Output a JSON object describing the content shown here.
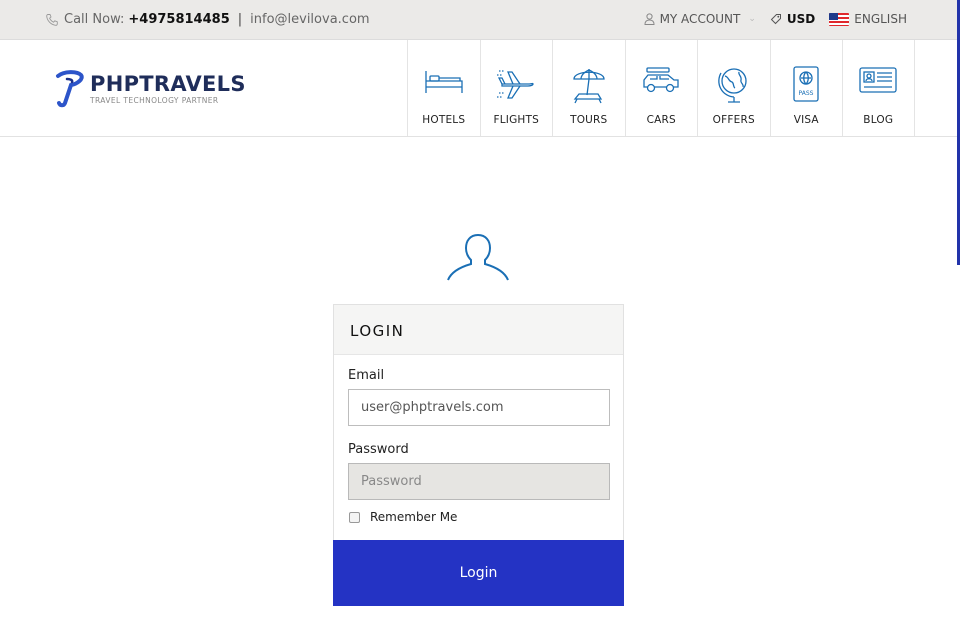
{
  "topbar": {
    "call_label": "Call Now:",
    "phone": "+4975814485",
    "separator": "|",
    "email": "info@levilova.com",
    "account_label": "MY ACCOUNT",
    "currency": "USD",
    "language": "ENGLISH"
  },
  "logo": {
    "title": "PHPTRAVELS",
    "subtitle": "TRAVEL TECHNOLOGY PARTNER"
  },
  "nav": {
    "items": [
      {
        "label": "HOTELS",
        "icon": "bed-icon"
      },
      {
        "label": "FLIGHTS",
        "icon": "plane-icon"
      },
      {
        "label": "TOURS",
        "icon": "beach-umbrella-icon"
      },
      {
        "label": "CARS",
        "icon": "car-icon"
      },
      {
        "label": "OFFERS",
        "icon": "globe-icon"
      },
      {
        "label": "VISA",
        "icon": "passport-icon"
      },
      {
        "label": "BLOG",
        "icon": "id-card-icon"
      }
    ]
  },
  "login": {
    "title": "LOGIN",
    "email_label": "Email",
    "email_value": "user@phptravels.com",
    "password_label": "Password",
    "password_placeholder": "Password",
    "remember_label": "Remember Me",
    "button_label": "Login"
  },
  "colors": {
    "accent": "#2433c4",
    "icon_blue": "#1a6fb5",
    "topbar_bg": "#ebeae8"
  }
}
